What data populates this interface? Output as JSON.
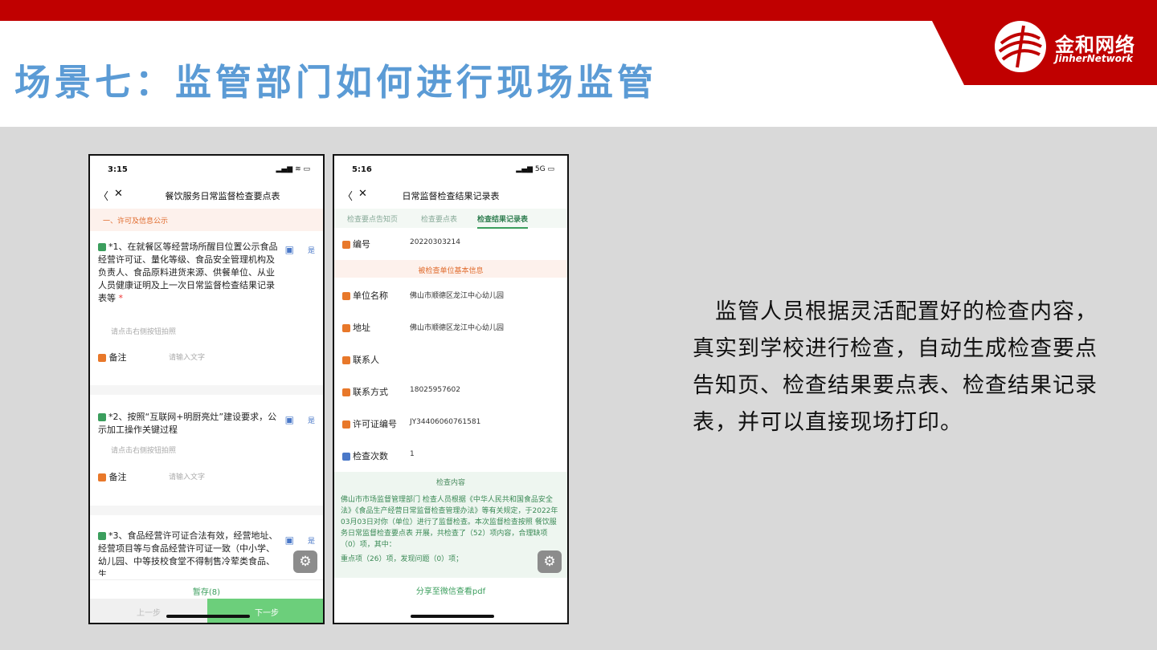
{
  "slide": {
    "title": "场景七：监管部门如何进行现场监管",
    "logo_cn": "金和网络",
    "logo_en": "JinherNetwork",
    "description": "　监管人员根据灵活配置好的检查内容，真实到学校进行检查，自动生成检查要点告知页、检查结果要点表、检查结果记录表，并可以直接现场打印。"
  },
  "phone1": {
    "time": "3:15",
    "signal": "▂▄▆ ≋ ▭",
    "back": "〈",
    "close": "✕",
    "title": "餐饮服务日常监督检查要点表",
    "section": "一、许可及信息公示",
    "items": [
      {
        "text": "*1、在就餐区等经营场所醒目位置公示食品经营许可证、量化等级、食品安全管理机构及负责人、食品原料进货来源、供餐单位、从业人员健康证明及上一次日常监督检查结果记录表等",
        "star": "*",
        "yes": "是"
      },
      {
        "text": "*2、按照“互联网+明厨亮灶”建设要求，公示加工操作关键过程",
        "yes": "是"
      },
      {
        "text": "*3、食品经营许可证合法有效，经营地址、经营项目等与食品经营许可证一致（中小学、幼儿园、中等技校食堂不得制售冷荤类食品、生",
        "yes": "是"
      }
    ],
    "hint": "请点击右侧按钮拍照",
    "remark_label": "备注",
    "remark_placeholder": "请输入文字",
    "save": "暂存(8)",
    "prev": "上一步",
    "next": "下一步"
  },
  "phone2": {
    "time": "5:16",
    "signal": "▂▄▆ 5G ▭",
    "back": "〈",
    "close": "✕",
    "title": "日常监督检查结果记录表",
    "tabs": [
      "检查要点告知页",
      "检查要点表",
      "检查结果记录表"
    ],
    "fields": [
      {
        "label": "编号",
        "value": "20220303214"
      },
      {
        "label": "单位名称",
        "value": "佛山市顺德区龙江中心幼儿园"
      },
      {
        "label": "地址",
        "value": "佛山市顺德区龙江中心幼儿园"
      },
      {
        "label": "联系人",
        "value": ""
      },
      {
        "label": "联系方式",
        "value": "18025957602"
      },
      {
        "label": "许可证编号",
        "value": "JY34406060761581"
      },
      {
        "label": "检查次数",
        "value": "1"
      }
    ],
    "band": "被检查单位基本信息",
    "content_head": "检查内容",
    "content_body": "佛山市市场监督管理部门 检查人员根据《中华人民共和国食品安全法》《食品生产经营日常监督检查管理办法》等有关规定，于2022年03月03日对你（单位）进行了监督检查。本次监督检查按照 餐饮服务日常监督检查要点表 开展，共检查了（52）项内容，合理缺项（0）项，其中：",
    "content_body2": "重点项（26）项，发现问题（0）项；",
    "share": "分享至微信查看pdf"
  }
}
